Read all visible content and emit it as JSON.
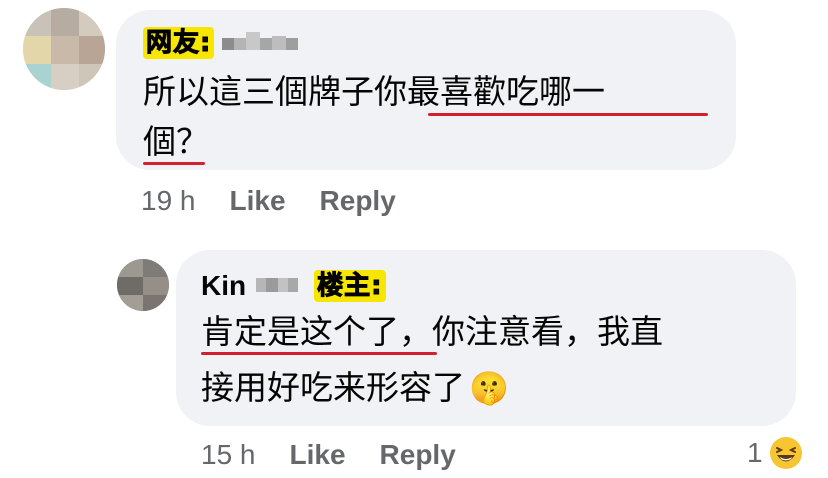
{
  "comment1": {
    "tag": "网友:",
    "text_line1": "所以這三個牌子你最喜歡吃哪一",
    "text_line2": "個？",
    "time": "19 h",
    "like": "Like",
    "reply": "Reply"
  },
  "comment2": {
    "author": "Kin",
    "tag": "楼主:",
    "text_line1": "肯定是这个了，你注意看，我直",
    "text_line2": "接用好吃来形容了",
    "emoji": "🤫",
    "time": "15 h",
    "like": "Like",
    "reply": "Reply",
    "reaction_count": "1",
    "reaction_icon": "laughing-emoji-icon"
  },
  "colors": {
    "bubble": "#f0f2f5",
    "underline": "#d3202f",
    "meta_gray": "#65676b",
    "tag_yellow": "#f7e600"
  }
}
